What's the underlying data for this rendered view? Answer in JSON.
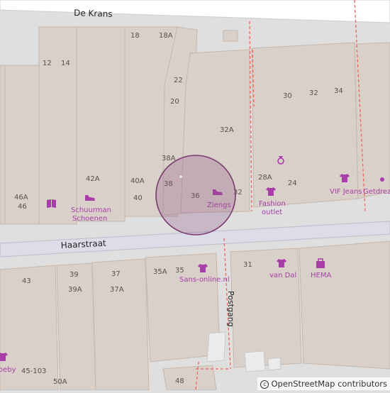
{
  "streets": {
    "de_krans": "De Krans",
    "haarstraat": "Haarstraat",
    "postgang": "Postgang"
  },
  "house_numbers": {
    "n18": "18",
    "n18a": "18A",
    "n12": "12",
    "n14": "14",
    "n22": "22",
    "n20": "20",
    "n30": "30",
    "n32": "32",
    "n34": "34",
    "n32a": "32A",
    "n38a": "38A",
    "n38": "38",
    "n36": "36",
    "n32b": "32",
    "n28a": "28A",
    "n24": "24",
    "n42a": "42A",
    "n40a": "40A",
    "n40": "40",
    "n46a": "46A",
    "n46": "46",
    "n43": "43",
    "n39": "39",
    "n39a": "39A",
    "n37": "37",
    "n37a": "37A",
    "n35a": "35A",
    "n35": "35",
    "n31": "31",
    "n45_103": "45-103",
    "n50a": "50A",
    "n48": "48"
  },
  "pois": {
    "schuurman_1": "Schuurman",
    "schuurman_2": "Schoenen",
    "ziengs": "Ziengs",
    "fashion_1": "Fashion",
    "fashion_2": "outlet",
    "vif": "VIF Jeans",
    "getdrez": "Getdrez",
    "sans_online": "Sans-online.nl",
    "van_dal": "van Dal",
    "hema": "HEMA",
    "zoeby": "oeby"
  },
  "colors": {
    "background": "#e0dfdf",
    "building": "#d9d0c9",
    "building_stroke": "#c4b6ab",
    "road": "#ffffff",
    "pedestrian": "#dddde8",
    "poi": "#a83fa8",
    "boundary": "#f0645a",
    "marker_fill": "#8b4e80"
  },
  "icons": {
    "shoe": "shoe-icon",
    "clothes": "shirt-icon",
    "jewellery": "ring-icon",
    "books": "book-icon",
    "department_store": "bag-icon"
  },
  "attribution": {
    "symbol": "c",
    "text": "OpenStreetMap contributors"
  }
}
